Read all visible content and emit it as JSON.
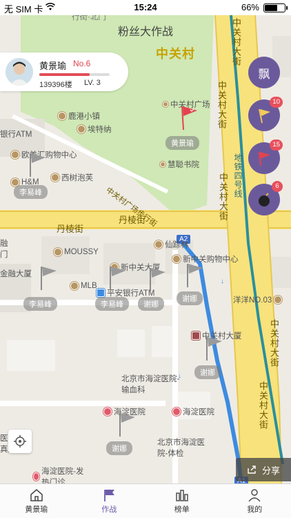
{
  "status_bar": {
    "carrier": "无 SIM 卡",
    "time": "15:24",
    "battery": "66%",
    "battery_level": 0.66
  },
  "map": {
    "title": "粉丝大作战",
    "labels": {
      "district": "中关村",
      "top_road": "行街·北门",
      "zgc_dajie_1": "中关村大街",
      "zgc_dajie_2": "中关村大街",
      "zgc_dajie_3": "中关村大街",
      "zgc_dajie_4": "中关村大街",
      "zgc_dajie_5": "中关村大街",
      "metro_line": "地铁四号线",
      "zgc_plaza_walk": "中关村广场步行街",
      "danleng_1": "丹棱街",
      "danleng_2": "丹棱街",
      "bank_atm": "银行ATM",
      "jin_left_1": "融",
      "jin_left_2": "门",
      "jin_building": "金融大厦",
      "road_a2": "A2",
      "road_a1": "A1",
      "hospital_left_1": "医院-",
      "hospital_left_2": "真舱"
    },
    "pois": [
      {
        "name": "鹿港小镇"
      },
      {
        "name": "埃特纳"
      },
      {
        "name": "中关村广场"
      },
      {
        "name": "欧美汇购物中心"
      },
      {
        "name": "慧聪书院"
      },
      {
        "name": "H&M"
      },
      {
        "name": "西树泡芙"
      },
      {
        "name": "仙踪林"
      },
      {
        "name": "MOUSSY"
      },
      {
        "name": "新中关大厦"
      },
      {
        "name": "新中关购物中心"
      },
      {
        "name": "MLB"
      },
      {
        "name": "平安银行ATM"
      },
      {
        "name": "洋洋NO.03"
      },
      {
        "name": "中关村大厦"
      },
      {
        "name": "北京市海淀医院-输血科"
      },
      {
        "name": "海淀医院"
      },
      {
        "name": "海淀医院"
      },
      {
        "name": "北京市海淀医院-体检"
      },
      {
        "name": "海淀医院-发热门诊"
      }
    ],
    "flags": [
      {
        "tag": "黄景瑜",
        "color": "red"
      },
      {
        "tag": "李易峰",
        "color": "gray"
      },
      {
        "tag": "李易峰",
        "color": "gray"
      },
      {
        "tag": "李易峰",
        "color": "gray"
      },
      {
        "tag": "谢娜",
        "color": "gray"
      },
      {
        "tag": "谢娜",
        "color": "gray"
      },
      {
        "tag": "谢娜",
        "color": "gray"
      },
      {
        "tag": "谢娜",
        "color": "gray"
      }
    ]
  },
  "user_card": {
    "name": "黄景瑜",
    "rank": "No.6",
    "floors": "139396楼",
    "level": "LV. 3",
    "progress": 0.72
  },
  "side_buttons": [
    {
      "label": "飘",
      "icon": "float-cloud-icon"
    },
    {
      "badge": "10",
      "icon": "yellow-flag-icon"
    },
    {
      "badge": "15",
      "icon": "red-flag-icon"
    },
    {
      "badge": "6",
      "icon": "bomb-icon"
    }
  ],
  "share_label": "分享",
  "tabs": [
    {
      "label": "黄景瑜",
      "icon": "home-icon"
    },
    {
      "label": "作战",
      "icon": "battle-flag-icon"
    },
    {
      "label": "榜单",
      "icon": "ranking-bars-icon"
    },
    {
      "label": "我的",
      "icon": "profile-icon"
    }
  ],
  "colors": {
    "accent": "#6d5ba8",
    "badge": "#e8505d",
    "flag_red": "#e2434f",
    "road_yellow": "#f8e27c",
    "green_area": "#cfe8b5",
    "metro": "#2a8f9c",
    "route_blue": "#3d8be0"
  }
}
